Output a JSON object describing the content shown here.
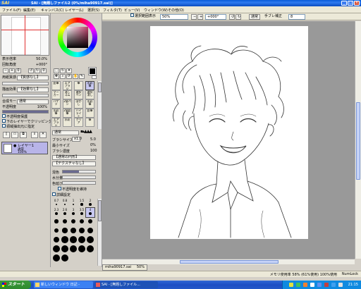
{
  "window": {
    "app_logo": "SAI",
    "app_logo_small": "PaintTool",
    "title": "SAI - [無題しファイル2 (0%/miha90917.sai)]"
  },
  "menu": {
    "items": [
      "ファイル(F)",
      "編集(E)",
      "キャンバス(C)",
      "レイヤー(L)",
      "選択(S)",
      "フィルタ(T)",
      "ビュー(V)",
      "ウィンドウ(W)",
      "その他(O)"
    ]
  },
  "toolbar": {
    "stabilize_label": "選択範囲表示",
    "zoom_value": "50%",
    "rotate_value": "+000°",
    "normal_label": "通常",
    "smooth_label": "手ブレ補正",
    "smooth_value": "8"
  },
  "navigator": {
    "zoom_label": "表示倍率",
    "zoom_value": "50.0%",
    "angle_label": "回転角度",
    "angle_value": "+000°",
    "paper_label": "用紙質感",
    "paper_value": "【質感なし】",
    "effect_label": "描画効果",
    "effect_value": "【効果なし】",
    "blend_label": "合成モード",
    "blend_value": "通常",
    "opacity_label": "不透明度",
    "opacity_value": "100%",
    "opacity_fraction": 1.0,
    "protect_label": "不透明度保護",
    "clip_label": "下のレイヤーでクリッピング",
    "select_label": "領域抽出元に指定"
  },
  "layer": {
    "name": "レイヤー1",
    "mode": "通常",
    "opacity": "100%"
  },
  "tools": {
    "items": [
      "鉛筆",
      "エアブラシ",
      "筆",
      "水彩筆",
      "マーカー",
      "消しゴム",
      "選択ペン",
      "選択消し",
      "バケツ",
      "2値ペン",
      "ぼかし",
      "水彩筆",
      "水彩筆",
      "2値鉛筆",
      "ハイライト",
      "鉛筆",
      "エアブラシ",
      "水彩",
      "クリア",
      "筆"
    ],
    "selected_index": 3
  },
  "brush": {
    "mode_label": "通常",
    "size_label": "ブラシサイズ",
    "size_value": "5.0",
    "size_multiplier": "x1.0",
    "min_label": "最小サイズ",
    "min_value": "0%",
    "density_label": "ブラシ濃度",
    "density_value": "100",
    "shape_label": "【通常の円形】",
    "texture_label": "【テクスチャなし】",
    "mix_label": "混色",
    "mix_value": "50",
    "water_label": "水分量",
    "water_value": "0",
    "persist_label": "色延び",
    "persist_value": "0",
    "keep_opacity_label": "不透明度を維持",
    "detail_label": "詳細設定",
    "dot_sizes": [
      "0.7",
      "0.8",
      "1",
      "1.5",
      "2",
      "2.3",
      "2.6",
      "3",
      "3.5",
      "4",
      "5",
      "6",
      "7",
      "8",
      "9",
      "10",
      "12",
      "14",
      "16",
      "20",
      "25",
      "30",
      "35",
      "40",
      "50",
      "60",
      "70",
      "80",
      "100",
      "120",
      "150",
      "200"
    ]
  },
  "canvas_tab": {
    "name": "miha90917.sai",
    "zoom": "50%"
  },
  "status": {
    "memory": "メモリ使用率 58% (61%使用) 100%使用",
    "mode": "NumLock"
  },
  "taskbar": {
    "start": "スタート",
    "tasks": [
      "新しいウィンドウ 日記 -",
      "SAI - [無題しファイル..."
    ],
    "clock": "21:15"
  }
}
